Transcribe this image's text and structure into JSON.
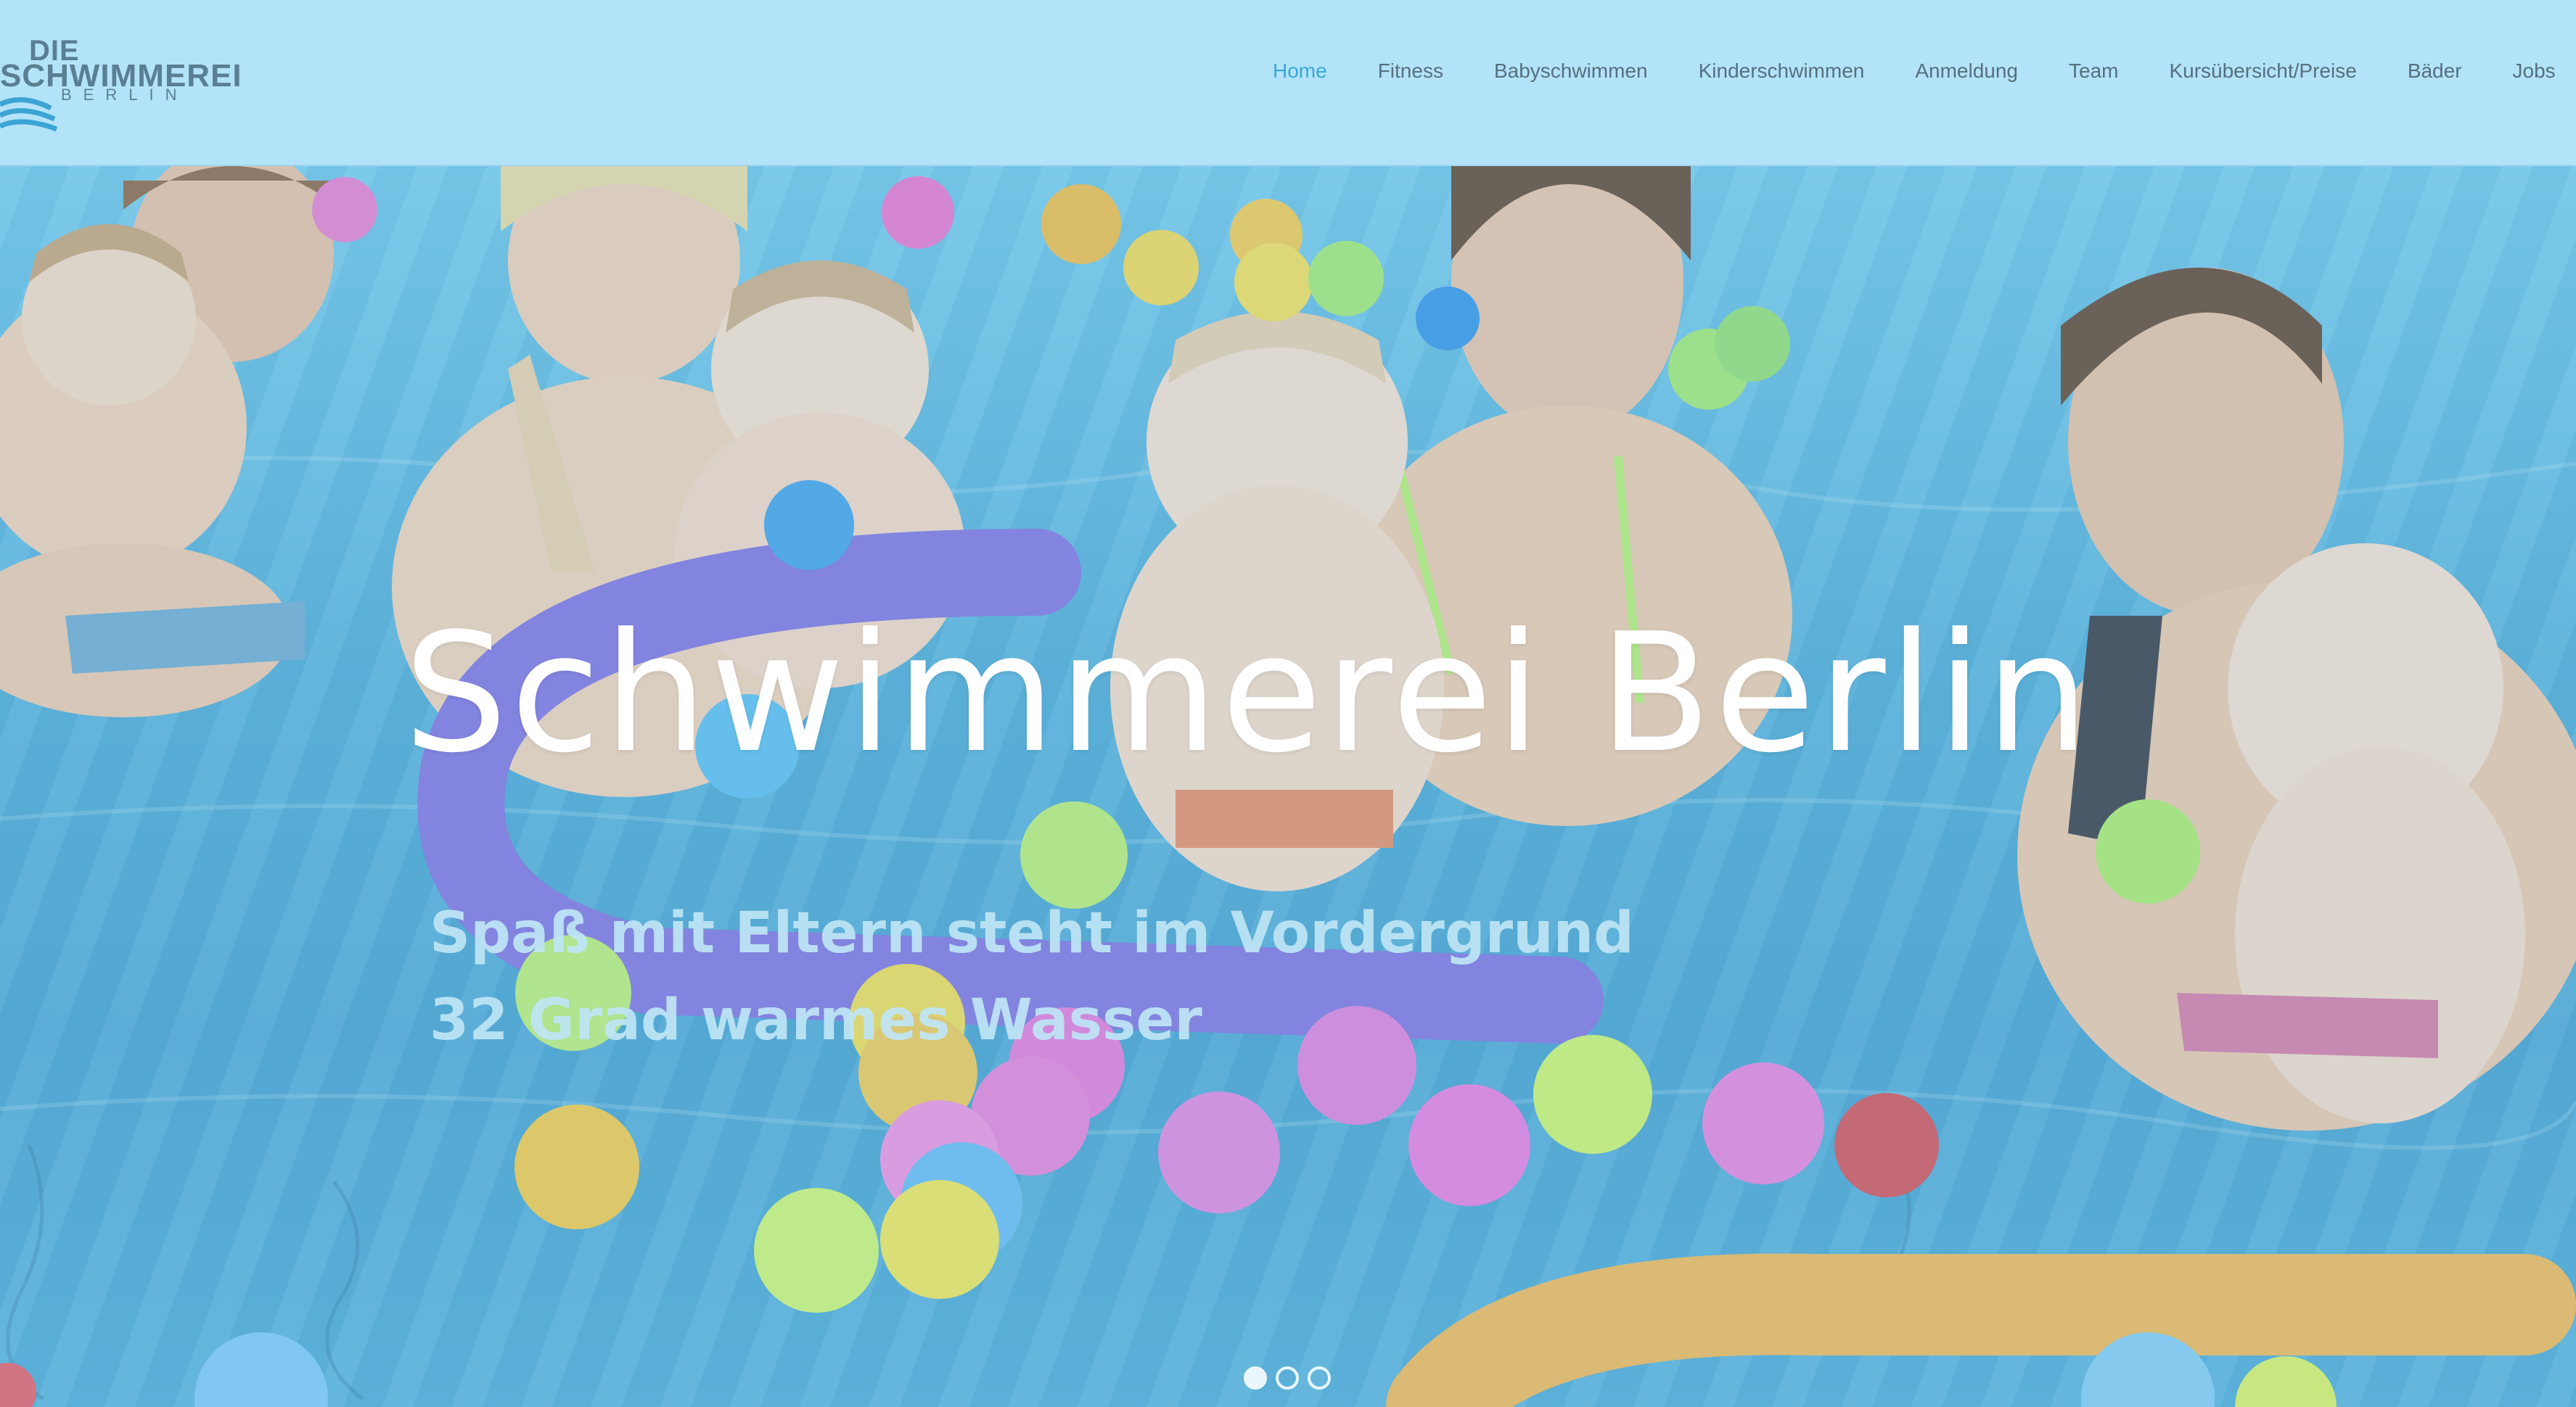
{
  "logo": {
    "line1": "DIE",
    "line2": "SCHWIMMEREI",
    "line3": "BERLIN"
  },
  "nav": {
    "items": [
      {
        "label": "Home",
        "active": true
      },
      {
        "label": "Fitness",
        "active": false
      },
      {
        "label": "Babyschwimmen",
        "active": false
      },
      {
        "label": "Kinderschwimmen",
        "active": false
      },
      {
        "label": "Anmeldung",
        "active": false
      },
      {
        "label": "Team",
        "active": false
      },
      {
        "label": "Kursübersicht/Preise",
        "active": false
      },
      {
        "label": "Bäder",
        "active": false
      },
      {
        "label": "Jobs",
        "active": false
      }
    ]
  },
  "hero": {
    "title": "Schwimmerei Berlin",
    "subtitle_1": "Spaß mit Eltern steht im Vordergrund",
    "subtitle_2": "32 Grad warmes Wasser",
    "slides": {
      "count": 3,
      "active_index": 0
    }
  },
  "colors": {
    "header_bg": "#b3e3f8",
    "nav_text": "#55707f",
    "nav_active": "#39a7d6",
    "water": "#4aa7d3"
  }
}
